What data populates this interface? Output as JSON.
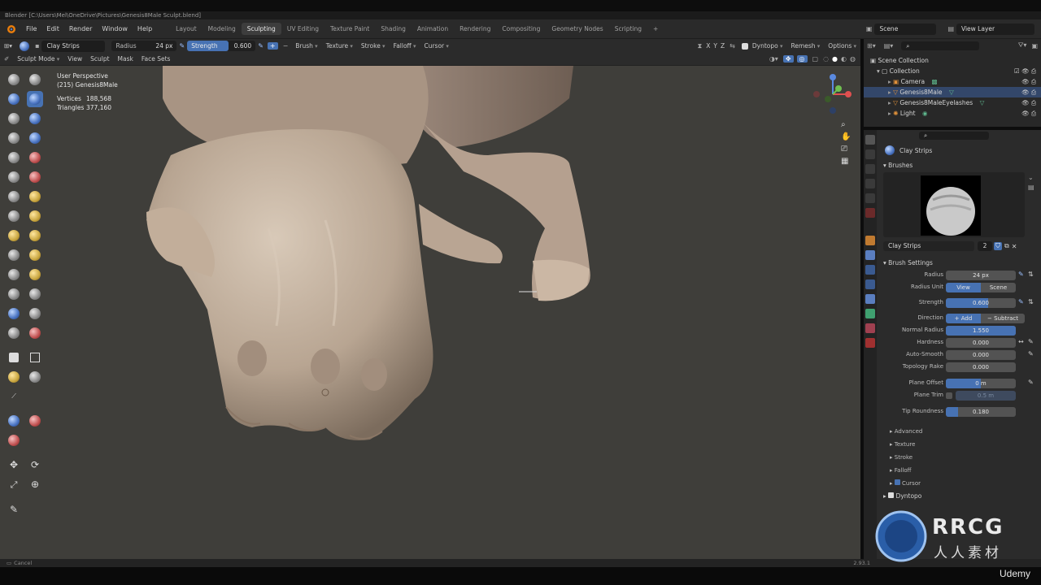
{
  "window": {
    "title": "Blender [C:\\Users\\Mel\\OneDrive\\Pictures\\Genesis8Male Sculpt.blend]"
  },
  "menu": [
    "File",
    "Edit",
    "Render",
    "Window",
    "Help"
  ],
  "workspaces": [
    "Layout",
    "Modeling",
    "Sculpting",
    "UV Editing",
    "Texture Paint",
    "Shading",
    "Animation",
    "Rendering",
    "Compositing",
    "Geometry Nodes",
    "Scripting"
  ],
  "active_workspace": "Sculpting",
  "scene": {
    "name": "Scene",
    "view_layer": "View Layer"
  },
  "tool_header": {
    "brush_name": "Clay Strips",
    "radius_label": "Radius",
    "radius_value": "24 px",
    "strength_label": "Strength",
    "strength_value": "0.600",
    "strength_fraction": 0.6,
    "menus": [
      "Brush",
      "Texture",
      "Stroke",
      "Falloff",
      "Cursor"
    ],
    "axes": [
      "X",
      "Y",
      "Z"
    ],
    "right_items": [
      "Dyntopo",
      "Remesh",
      "Options"
    ]
  },
  "view_header": {
    "mode": "Sculpt Mode",
    "menus": [
      "View",
      "Sculpt",
      "Mask",
      "Face Sets"
    ]
  },
  "viewport": {
    "perspective": "User Perspective",
    "object": "(215) Genesis8Male",
    "vertices_label": "Vertices",
    "vertices_value": "188,568",
    "triangles_label": "Triangles",
    "triangles_value": "377,160"
  },
  "outliner": {
    "root": "Scene Collection",
    "collection": "Collection",
    "items": [
      {
        "name": "Camera",
        "selected": false,
        "color": "#e0913a"
      },
      {
        "name": "Genesis8Male",
        "selected": true,
        "color": "#e0913a"
      },
      {
        "name": "Genesis8MaleEyelashes",
        "selected": false,
        "color": "#e0913a"
      },
      {
        "name": "Light",
        "selected": false,
        "color": "#e0913a"
      }
    ]
  },
  "properties": {
    "tool_name": "Clay Strips",
    "brushes_label": "Brushes",
    "brush_field": "Clay Strips",
    "brush_users": "2",
    "brush_settings_label": "Brush Settings",
    "radius": {
      "label": "Radius",
      "value": "24 px"
    },
    "radius_unit": {
      "label": "Radius Unit",
      "options": [
        "View",
        "Scene"
      ]
    },
    "strength": {
      "label": "Strength",
      "value": "0.600",
      "fraction": 0.6
    },
    "direction": {
      "label": "Direction",
      "options": [
        "Add",
        "Subtract"
      ]
    },
    "normal_radius": {
      "label": "Normal Radius",
      "value": "1.550",
      "fraction": 1.0
    },
    "hardness": {
      "label": "Hardness",
      "value": "0.000"
    },
    "auto_smooth": {
      "label": "Auto-Smooth",
      "value": "0.000"
    },
    "topology_rake": {
      "label": "Topology Rake",
      "value": "0.000"
    },
    "plane_offset": {
      "label": "Plane Offset",
      "value": "0 m",
      "fraction": 0.5
    },
    "plane_trim": {
      "label": "Plane Trim",
      "value": "0.5 m"
    },
    "tip_roundness": {
      "label": "Tip Roundness",
      "value": "0.180",
      "fraction": 0.18
    },
    "subpanels": [
      "Advanced",
      "Texture",
      "Stroke",
      "Falloff",
      "Cursor"
    ],
    "dyntopo": "Dyntopo"
  },
  "status": {
    "left": "Cancel",
    "version": "2.93.1"
  },
  "watermark": {
    "brand": "RRCG",
    "sub": "人人素材",
    "udemy": "Udemy"
  },
  "colors": {
    "accent": "#4772b3",
    "viewport_bg": "#3f3e3a",
    "selected_row": "#33476a"
  }
}
